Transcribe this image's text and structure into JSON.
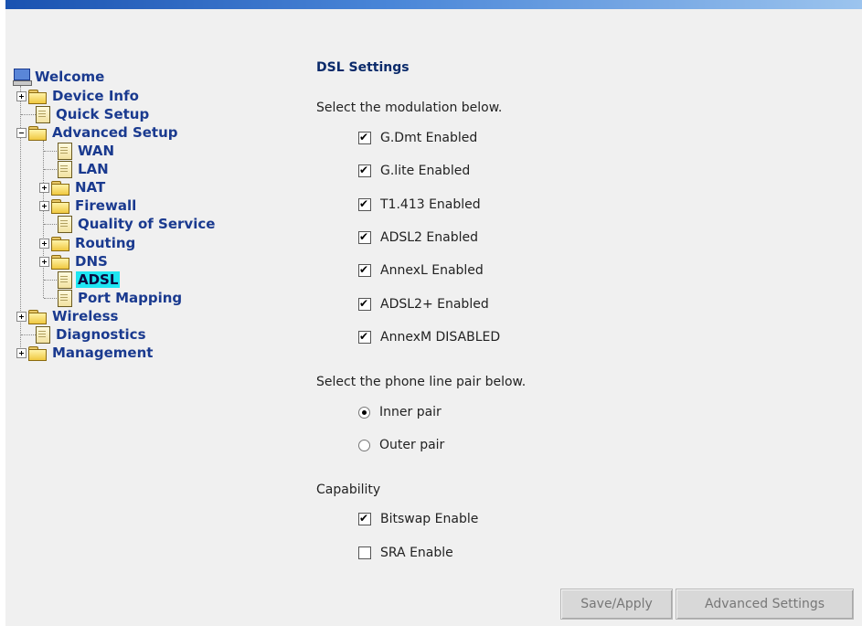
{
  "nav": {
    "welcome": "Welcome",
    "device_info": "Device Info",
    "quick_setup": "Quick Setup",
    "advanced_setup": "Advanced Setup",
    "wan": "WAN",
    "lan": "LAN",
    "nat": "NAT",
    "firewall": "Firewall",
    "qos": "Quality of Service",
    "routing": "Routing",
    "dns": "DNS",
    "adsl": "ADSL",
    "port_mapping": "Port Mapping",
    "wireless": "Wireless",
    "diagnostics": "Diagnostics",
    "management": "Management",
    "selected": "ADSL",
    "selected_color": "#1ee6f2"
  },
  "main": {
    "title": "DSL Settings",
    "modulation_prompt": "Select the modulation below.",
    "modulations": [
      {
        "label": "G.Dmt Enabled",
        "checked": true
      },
      {
        "label": "G.lite Enabled",
        "checked": true
      },
      {
        "label": "T1.413 Enabled",
        "checked": true
      },
      {
        "label": "ADSL2 Enabled",
        "checked": true
      },
      {
        "label": "AnnexL Enabled",
        "checked": true
      },
      {
        "label": "ADSL2+ Enabled",
        "checked": true
      },
      {
        "label": "AnnexM DISABLED",
        "checked": true
      }
    ],
    "pair_prompt": "Select the phone line pair below.",
    "pairs": [
      {
        "label": "Inner pair",
        "selected": true
      },
      {
        "label": "Outer pair",
        "selected": false
      }
    ],
    "capability_label": "Capability",
    "capabilities": [
      {
        "label": "Bitswap Enable",
        "checked": true
      },
      {
        "label": "SRA Enable",
        "checked": false
      }
    ],
    "save_button": "Save/Apply",
    "advanced_button": "Advanced Settings"
  }
}
